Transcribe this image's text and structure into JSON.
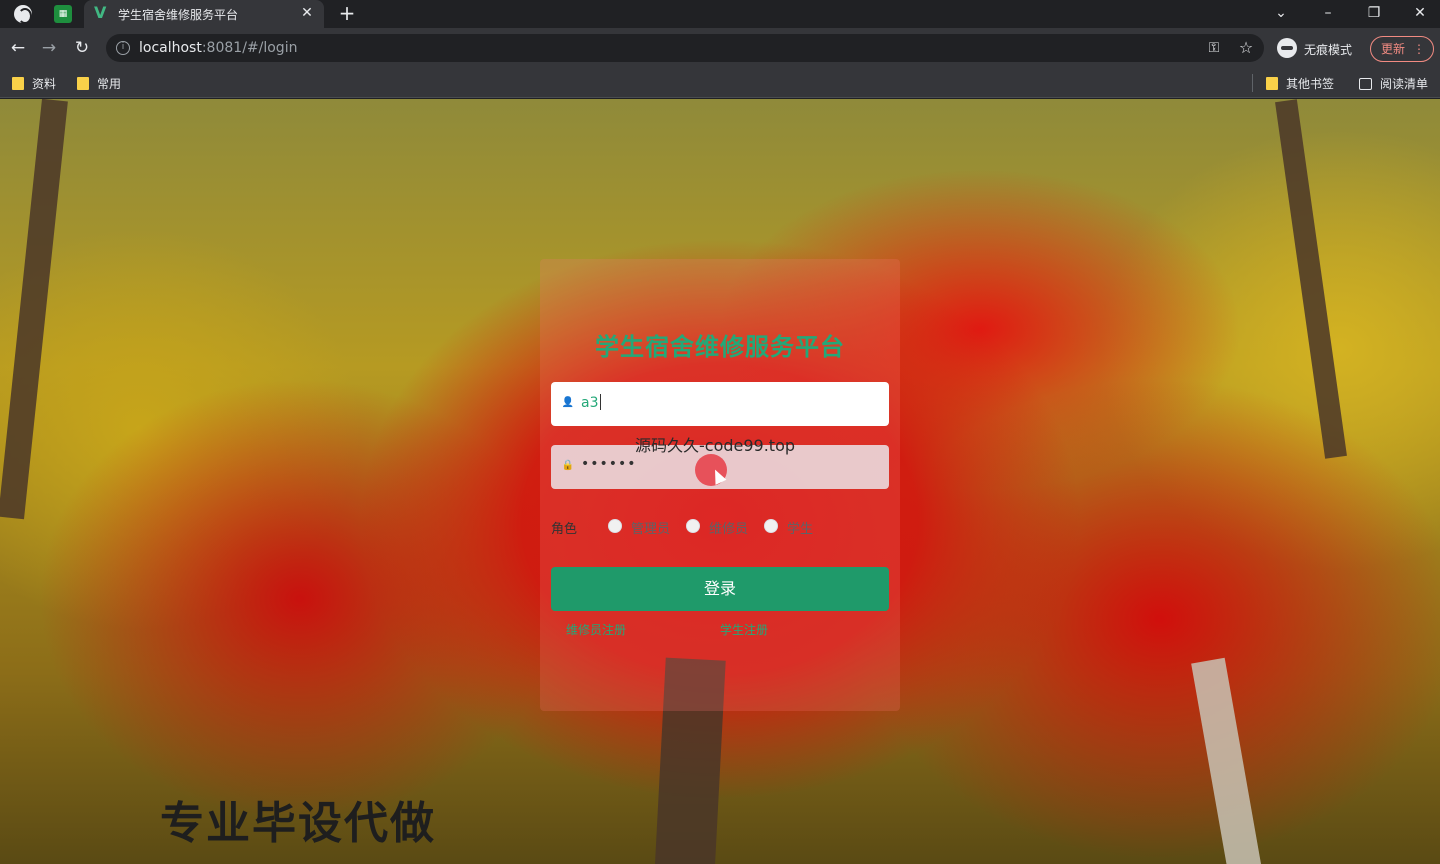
{
  "browser": {
    "tab_title": "学生宿舍维修服务平台",
    "url_host": "localhost",
    "url_rest": ":8081/#/login",
    "incognito_label": "无痕模式",
    "update_label": "更新",
    "bookmarks": [
      "资料",
      "常用"
    ],
    "bookmarks_right": [
      "其他书签",
      "阅读清单"
    ]
  },
  "login": {
    "title": "学生宿舍维修服务平台",
    "username_value": "a3",
    "password_value": "••••••",
    "role_label": "角色",
    "roles": [
      "管理员",
      "维修员",
      "学生"
    ],
    "login_button": "登录",
    "links": [
      "维修员注册",
      "学生注册"
    ]
  },
  "overlay": {
    "watermark": "源码久久-code99.top",
    "promo": "专业毕设代做"
  }
}
